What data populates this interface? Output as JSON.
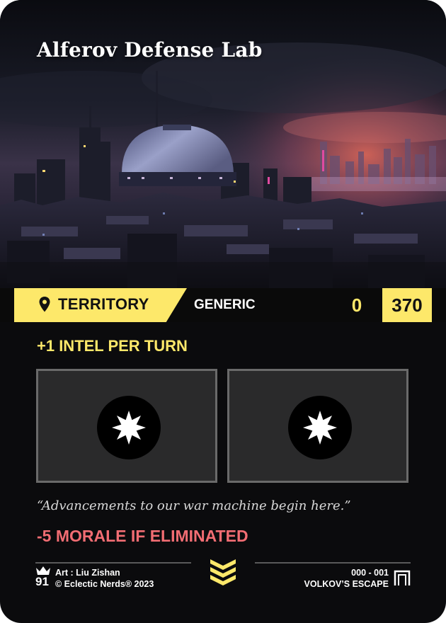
{
  "card": {
    "title": "Alferov Defense Lab",
    "artwork": "night city skyline with observatory dome",
    "type_icon": "location-pin-icon",
    "type": "TERRITORY",
    "subtype": "GENERIC",
    "stat_left": "0",
    "stat_right": "370",
    "effect": "+1 INTEL PER TURN",
    "slots": [
      {
        "icon": "eight-point-star-icon"
      },
      {
        "icon": "eight-point-star-icon"
      }
    ],
    "flavor_text": "“Advancements to our war machine begin here.”",
    "penalty": "-5 MORALE IF ELIMINATED"
  },
  "footer": {
    "rarity_icon": "crown-icon",
    "card_number": "91",
    "artist": "Art : Liu Zishan",
    "copyright": "© Eclectic Nerds® 2023",
    "center_icon": "chevrons-down-icon",
    "set_number": "000 - 001",
    "set_name": "VOLKOV’S ESCAPE",
    "set_icon": "gate-icon"
  },
  "colors": {
    "accent_yellow": "#fde86a",
    "penalty_red": "#f26d73",
    "card_background": "#0b0b0d",
    "slot_background": "#2a2a2b",
    "slot_border": "#6a6a6a"
  }
}
